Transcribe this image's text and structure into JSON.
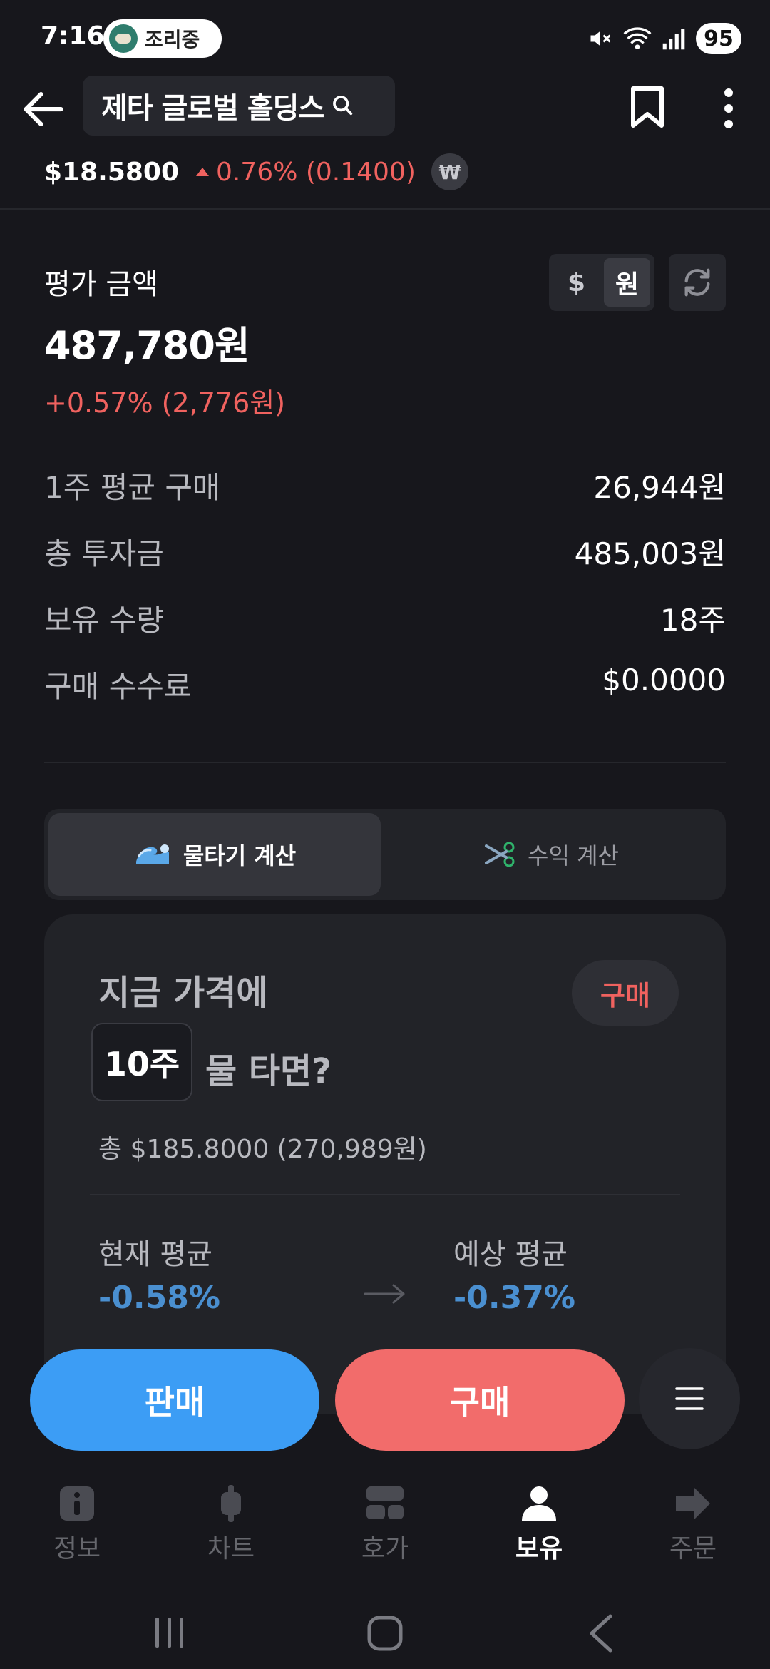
{
  "status_bar": {
    "time": "7:16",
    "pill_text": "조리중",
    "battery": "95"
  },
  "header": {
    "title": "제타 글로벌 홀딩스",
    "price": "$18.5800",
    "change": "0.76% (0.1400)",
    "currency_badge": "₩"
  },
  "valuation": {
    "label": "평가 금액",
    "amount": "487,780원",
    "change": "+0.57% (2,776원)",
    "toggle_dollar": "$",
    "toggle_won": "원"
  },
  "info_rows": [
    {
      "label": "1주 평균 구매",
      "value": "26,944원"
    },
    {
      "label": "총 투자금",
      "value": "485,003원"
    },
    {
      "label": "보유 수량",
      "value": "18주"
    },
    {
      "label": "구매 수수료",
      "value": "$0.0000"
    }
  ],
  "calc_tabs": {
    "average_down": "물타기 계산",
    "profit": "수익 계산"
  },
  "calc_card": {
    "line1": "지금 가격에",
    "quantity": "10주",
    "line2": "물 타면?",
    "buy_label": "구매",
    "total": "총 $185.8000 (270,989원)",
    "current_avg_label": "현재 평균",
    "current_avg_value": "-0.58%",
    "expected_avg_label": "예상 평균",
    "expected_avg_value": "-0.37%"
  },
  "actions": {
    "sell": "판매",
    "buy": "구매"
  },
  "nav": [
    {
      "label": "정보",
      "icon": "info-icon"
    },
    {
      "label": "차트",
      "icon": "chart-icon"
    },
    {
      "label": "호가",
      "icon": "orderbook-icon"
    },
    {
      "label": "보유",
      "icon": "person-icon"
    },
    {
      "label": "주문",
      "icon": "arrow-icon"
    }
  ],
  "colors": {
    "background": "#17171c",
    "rise": "#f0625f",
    "sell": "#3c9df5",
    "buy": "#f26c6b",
    "fall_text": "#4a8fd0"
  }
}
